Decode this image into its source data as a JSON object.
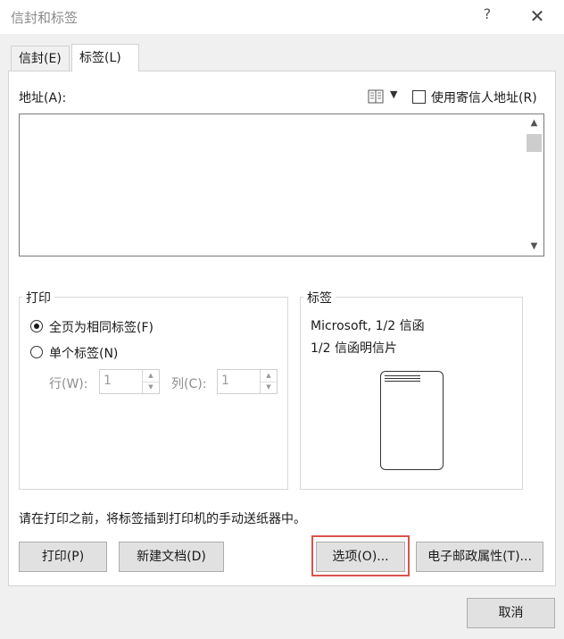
{
  "window": {
    "title": "信封和标签",
    "help": "?",
    "close": "✕"
  },
  "tabs": [
    {
      "label": "信封(E)"
    },
    {
      "label": "标签(L)"
    }
  ],
  "address": {
    "label": "地址(A):",
    "use_return_address": "使用寄信人地址(R)",
    "value": ""
  },
  "print_group": {
    "title": "打印",
    "full_page": "全页为相同标签(F)",
    "single_label": "单个标签(N)",
    "row_label": "行(W):",
    "row_value": "1",
    "col_label": "列(C):",
    "col_value": "1"
  },
  "label_group": {
    "title": "标签",
    "line1": "Microsoft, 1/2 信函",
    "line2": "1/2 信函明信片"
  },
  "instruction": "请在打印之前，将标签插到打印机的手动送纸器中。",
  "buttons": {
    "print": "打印(P)",
    "new_document": "新建文档(D)",
    "options": "选项(O)...",
    "postage": "电子邮政属性(T)...",
    "cancel": "取消"
  },
  "colors": {
    "highlight": "#d9534f",
    "panel": "#ffffff",
    "chrome": "#f0f0f0"
  }
}
